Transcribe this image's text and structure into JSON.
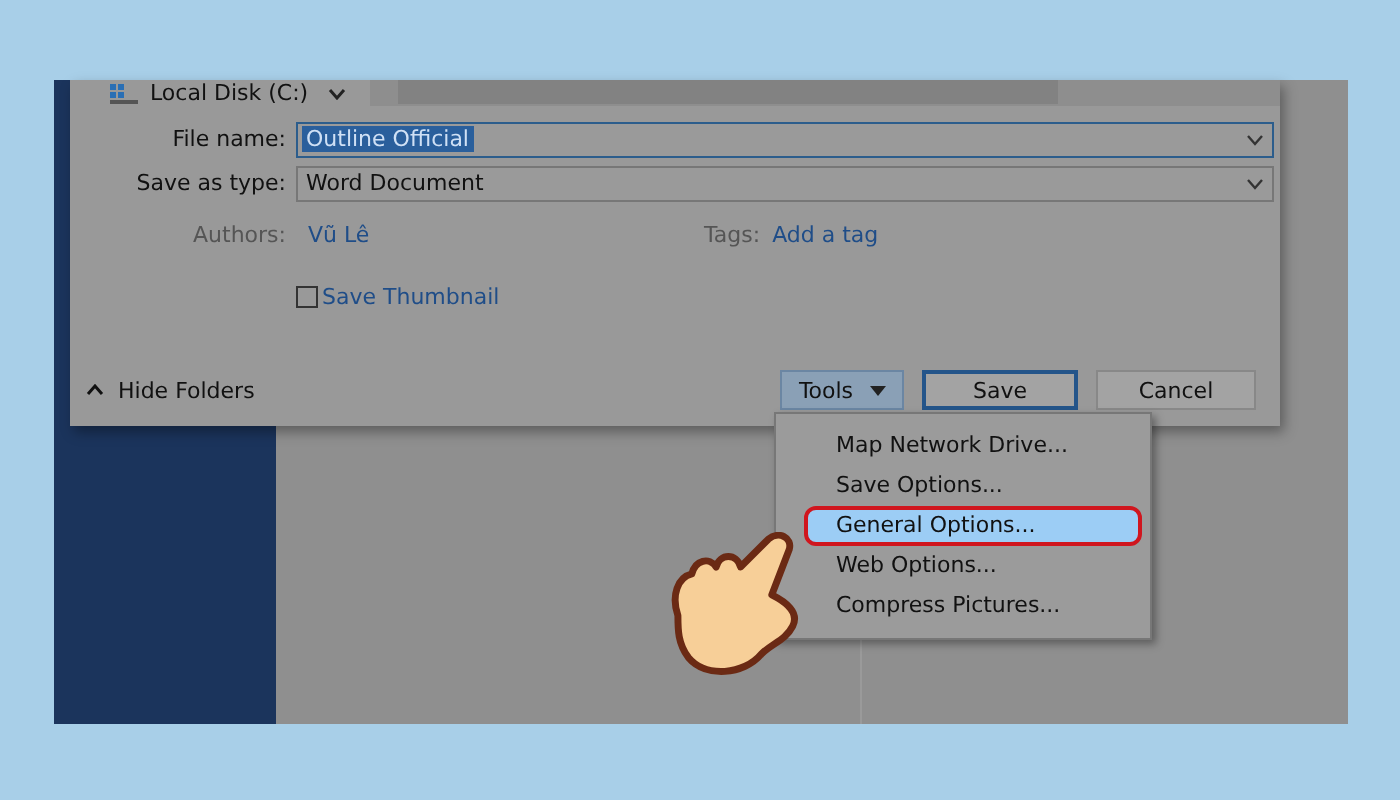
{
  "dialog": {
    "location": "Local Disk (C:)",
    "fields": [
      {
        "label": "File name:",
        "value": "Outline Official",
        "focused": true
      },
      {
        "label": "Save as type:",
        "value": "Word Document",
        "focused": false
      }
    ],
    "authors": {
      "label": "Authors:",
      "value": "Vũ Lê"
    },
    "tags": {
      "label": "Tags:",
      "value": "Add a tag"
    },
    "thumbnail": {
      "label": "Save Thumbnail",
      "checked": false
    },
    "hide_folders": "Hide Folders",
    "buttons": [
      {
        "label": "Tools",
        "kind": "menu"
      },
      {
        "label": "Save",
        "kind": "default"
      },
      {
        "label": "Cancel",
        "kind": "plain"
      }
    ]
  },
  "tools_menu": [
    {
      "label": "Map Network Drive...",
      "selected": false
    },
    {
      "label": "Save Options...",
      "selected": false
    },
    {
      "label": "General Options...",
      "selected": true
    },
    {
      "label": "Web Options...",
      "selected": false
    },
    {
      "label": "Compress Pictures...",
      "selected": false
    }
  ]
}
